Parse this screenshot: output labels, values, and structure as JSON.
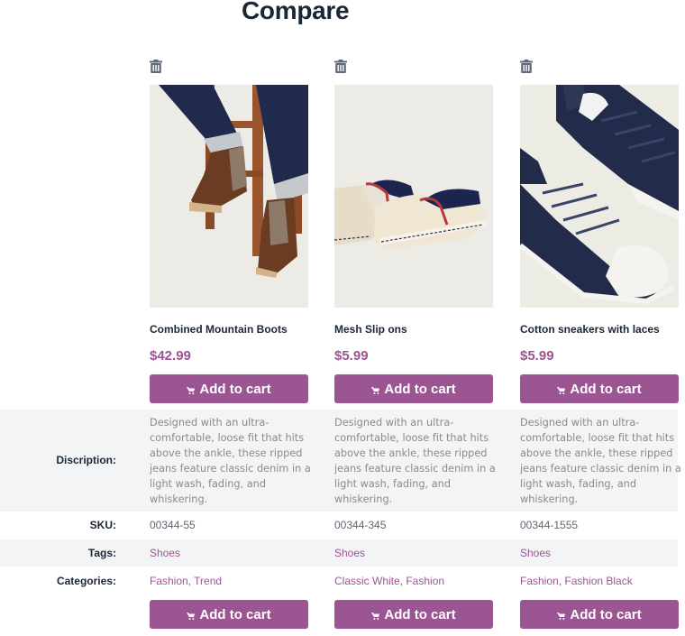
{
  "page": {
    "title": "Compare"
  },
  "theme": {
    "accent": "#9b5593",
    "heading": "#1b2638",
    "row_shade": "#f3f4f6"
  },
  "labels": {
    "description": "Discription:",
    "sku": "SKU:",
    "tags": "Tags:",
    "categories": "Categories:"
  },
  "products": [
    {
      "name": "Combined Mountain Boots",
      "price": "$42.99",
      "image_alt": "Brown leather mountain boots with dark denim jeans on wooden stool",
      "add_to_cart_label": "Add to cart",
      "description": "Designed with an ultra-comfortable, loose fit that hits above the ankle, these ripped jeans feature classic denim in a light wash, fading, and whiskering.",
      "sku": "00344-55",
      "tags": "Shoes",
      "categories": "Fashion, Trend",
      "remove_icon": "trash-icon"
    },
    {
      "name": "Mesh Slip ons",
      "price": "$5.99",
      "image_alt": "Cream mesh slip-on espadrilles with red and navy trim",
      "add_to_cart_label": "Add to cart",
      "description": "Designed with an ultra-comfortable, loose fit that hits above the ankle, these ripped jeans feature classic denim in a light wash, fading, and whiskering.",
      "sku": "00344-345",
      "tags": "Shoes",
      "categories": "Classic White, Fashion",
      "remove_icon": "trash-icon"
    },
    {
      "name": "Cotton sneakers with laces",
      "price": "$5.99",
      "image_alt": "Navy cotton low-top sneakers with white rubber toe caps",
      "add_to_cart_label": "Add to cart",
      "description": "Designed with an ultra-comfortable, loose fit that hits above the ankle, these ripped jeans feature classic denim in a light wash, fading, and whiskering.",
      "sku": "00344-1555",
      "tags": "Shoes",
      "categories": "Fashion, Fashion Black",
      "remove_icon": "trash-icon"
    }
  ]
}
